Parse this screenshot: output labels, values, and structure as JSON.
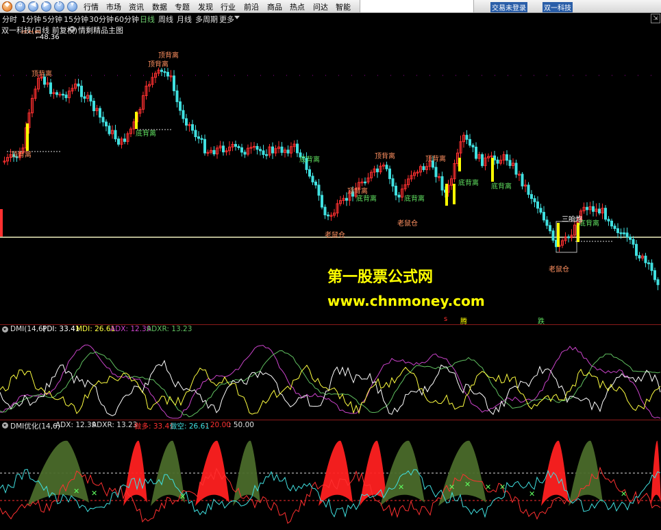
{
  "nav": {
    "menu": [
      "行情",
      "市场",
      "资讯",
      "数据",
      "专题",
      "发现",
      "行业",
      "前沿",
      "商品",
      "热点",
      "问达",
      "智能"
    ],
    "right": [
      "交易未登录",
      "双一科技"
    ]
  },
  "periods": [
    "分时",
    "1分钟",
    "5分钟",
    "15分钟",
    "30分钟",
    "60分钟",
    "日线",
    "周线",
    "月线",
    "多周期",
    "更多"
  ],
  "active_period": "日线",
  "stock": {
    "name": "双一科技(日线 前复权)",
    "template": "情剩精品主图"
  },
  "price_labels": {
    "high_value": "48.36",
    "top_clipped": "顶背离",
    "ding": "顶背离",
    "di": "底背离",
    "laoshu": "老鼠仓",
    "sanxiang": "三响炮",
    "teng": "腾",
    "yue": "跌",
    "s": "s"
  },
  "watermark": {
    "line1": "第一股票公式网",
    "line2": "www.chnmoney.com"
  },
  "dmi": {
    "name": "DMI(14,6)",
    "pdi": "PDI: 33.41",
    "mdi": "MDI: 26.61",
    "adx": "ADX: 12.39",
    "adxr": "ADXR: 13.23"
  },
  "dmi_opt": {
    "name": "DMI优化(14,6)",
    "adx": "ADX: 12.39",
    "adxr": "ADXR: 13.23",
    "duo": "做多: 33.41",
    "kong": "做空: 26.61",
    "v20": ": 20.00",
    "v50": ": 50.00"
  },
  "colors": {
    "up": "#ff3030",
    "down": "#40e0e0",
    "yellow": "#ffff00",
    "pdi": "#ffffff",
    "mdi": "#ffff40",
    "adx": "#cc44cc",
    "adxr": "#60c060"
  }
}
